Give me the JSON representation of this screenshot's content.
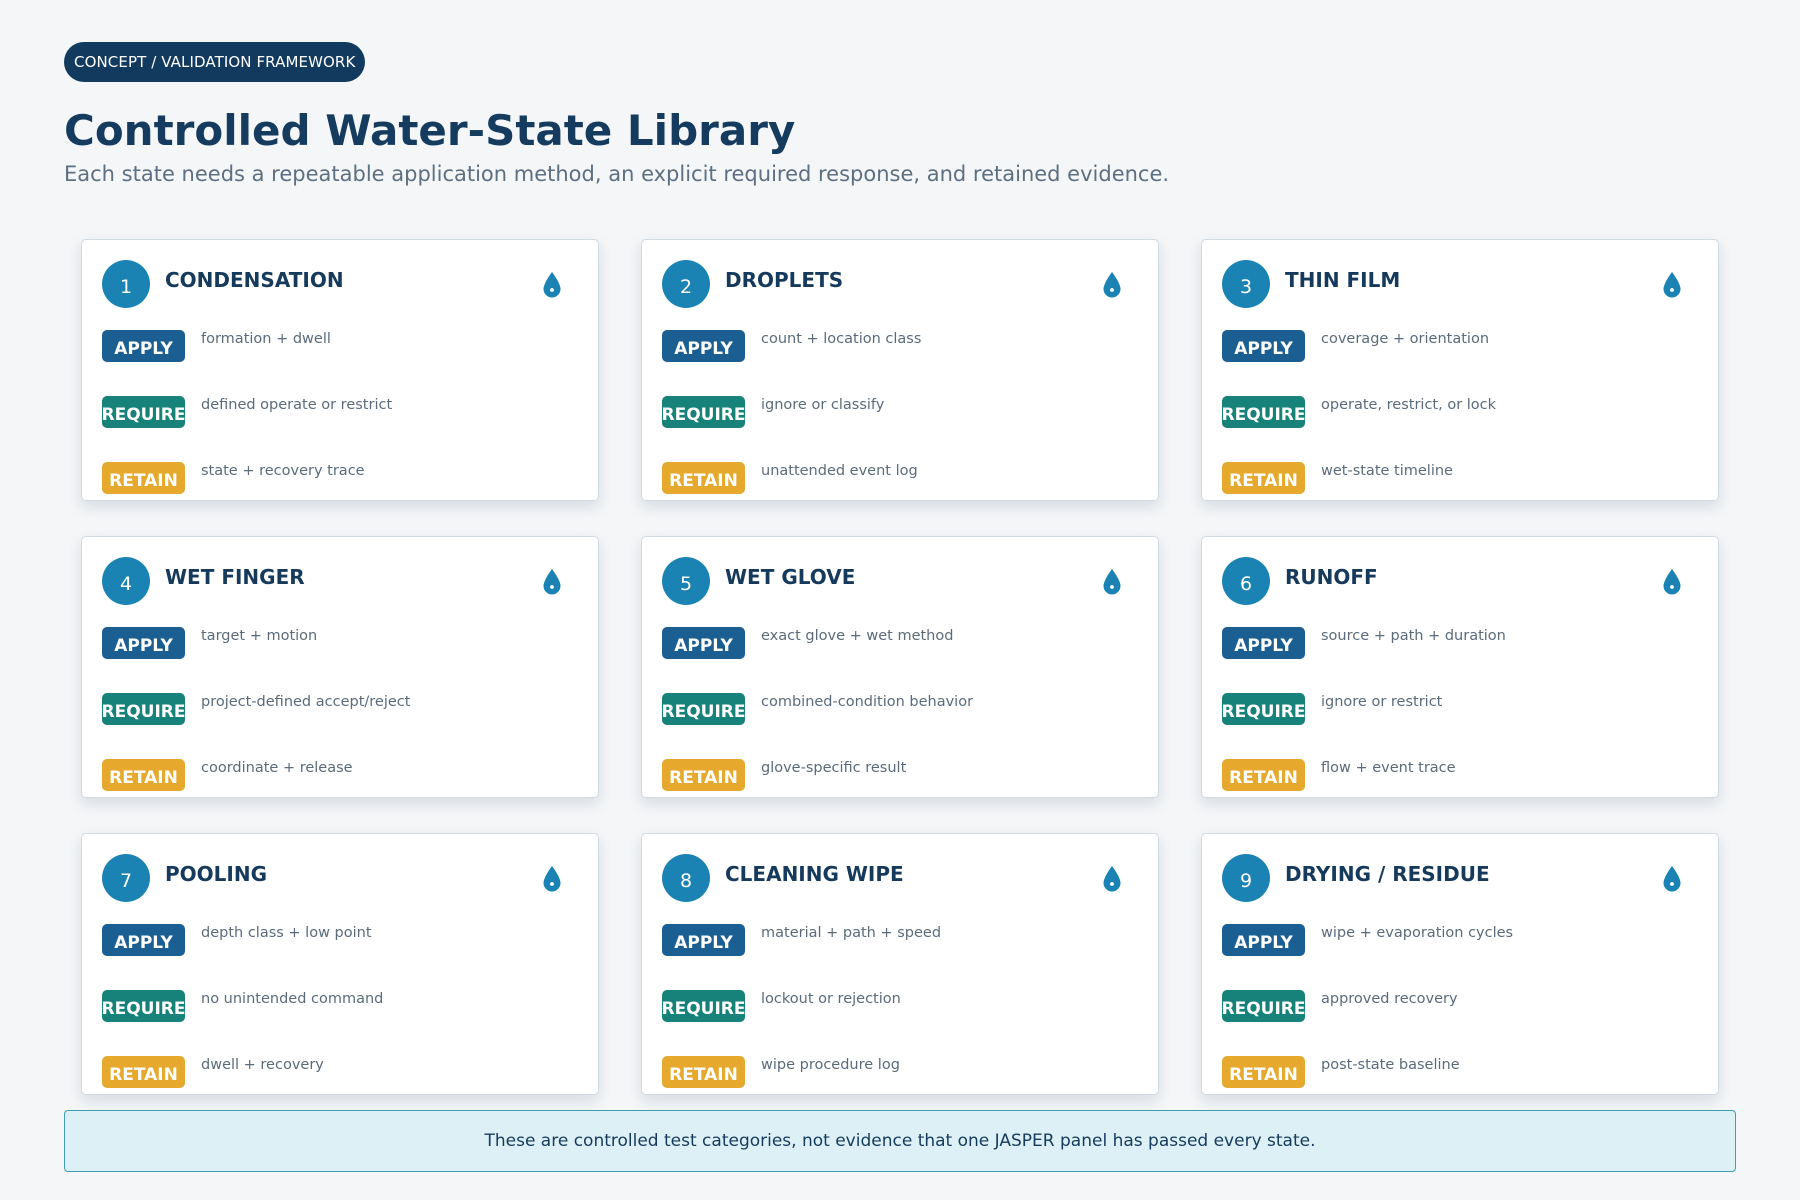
{
  "header": {
    "eyebrow": "CONCEPT / VALIDATION FRAMEWORK",
    "title": "Controlled Water-State Library",
    "subtitle": "Each state needs a repeatable application method, an explicit required response, and retained evidence."
  },
  "labels": {
    "apply": "APPLY",
    "require": "REQUIRE",
    "retain": "RETAIN"
  },
  "icons": {
    "card_icon": "water-drop-icon"
  },
  "colors": {
    "apply": "#1b5f92",
    "require": "#17827a",
    "retain": "#e6a92d",
    "number_circle": "#1a83b3",
    "footer_bg": "#dcf0f6",
    "footer_border": "#3f9fb0"
  },
  "cards": [
    {
      "number": "1",
      "title": "CONDENSATION",
      "apply": "formation + dwell",
      "require": "defined operate or restrict",
      "retain": "state + recovery trace"
    },
    {
      "number": "2",
      "title": "DROPLETS",
      "apply": "count + location class",
      "require": "ignore or classify",
      "retain": "unattended event log"
    },
    {
      "number": "3",
      "title": "THIN FILM",
      "apply": "coverage + orientation",
      "require": "operate, restrict, or lock",
      "retain": "wet-state timeline"
    },
    {
      "number": "4",
      "title": "WET FINGER",
      "apply": "target + motion",
      "require": "project-defined accept/reject",
      "retain": "coordinate + release"
    },
    {
      "number": "5",
      "title": "WET GLOVE",
      "apply": "exact glove + wet method",
      "require": "combined-condition behavior",
      "retain": "glove-specific result"
    },
    {
      "number": "6",
      "title": "RUNOFF",
      "apply": "source + path + duration",
      "require": "ignore or restrict",
      "retain": "flow + event trace"
    },
    {
      "number": "7",
      "title": "POOLING",
      "apply": "depth class + low point",
      "require": "no unintended command",
      "retain": "dwell + recovery"
    },
    {
      "number": "8",
      "title": "CLEANING WIPE",
      "apply": "material + path + speed",
      "require": "lockout or rejection",
      "retain": "wipe procedure log"
    },
    {
      "number": "9",
      "title": "DRYING / RESIDUE",
      "apply": "wipe + evaporation cycles",
      "require": "approved recovery",
      "retain": "post-state baseline"
    }
  ],
  "footer": {
    "note": "These are controlled test categories, not evidence that one JASPER panel has passed every state."
  }
}
